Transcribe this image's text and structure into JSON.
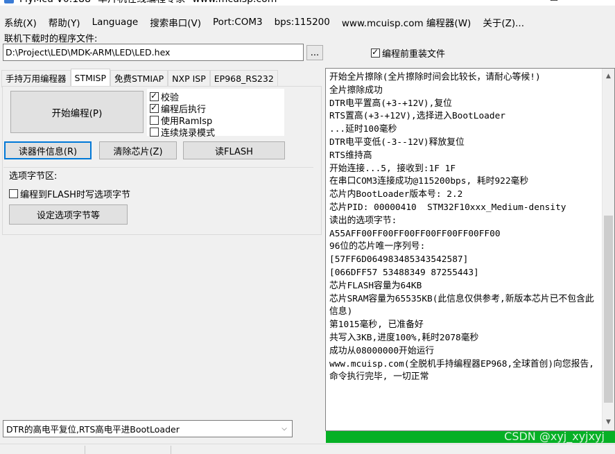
{
  "window": {
    "title": "FlyMcu V0.188--单片机在线编程专家--www.mcuisp.com",
    "minimize": "—",
    "maximize": "☐",
    "close": "✕"
  },
  "menu": [
    "系统(X)",
    "帮助(Y)",
    "Language",
    "搜索串口(V)",
    "Port:COM3",
    "bps:115200",
    "www.mcuisp.com 编程器(W)",
    "关于(Z)..."
  ],
  "file": {
    "label": "联机下载时的程序文件:",
    "path": "D:\\Project\\LED\\MDK-ARM\\LED\\LED.hex",
    "browse_label": "...",
    "reload_label": "编程前重装文件",
    "reload_checked": true
  },
  "tabs": [
    "手持万用编程器",
    "STMISP",
    "免费STMIAP",
    "NXP ISP",
    "EP968_RS232"
  ],
  "active_tab": "STMISP",
  "stmisp": {
    "start_program": "开始编程(P)",
    "verify": "校验",
    "run_after": "编程后执行",
    "use_ramisp": "使用RamIsp",
    "continuous": "连续烧录模式",
    "read_info": "读器件信息(R)",
    "erase_chip": "清除芯片(Z)",
    "read_flash": "读FLASH",
    "option_group": "选项字节区:",
    "write_option": "编程到FLASH时写选项字节",
    "set_option": "设定选项字节等"
  },
  "log_lines": [
    "开始全片擦除(全片擦除时间会比较长，请耐心等候!)",
    "全片擦除成功",
    "DTR电平置高(+3-+12V),复位",
    "RTS置高(+3-+12V),选择进入BootLoader",
    "...延时100毫秒",
    "DTR电平变低(-3--12V)释放复位",
    "RTS维持高",
    "开始连接...5, 接收到:1F 1F",
    "在串口COM3连接成功@115200bps, 耗时922毫秒",
    "芯片内BootLoader版本号: 2.2",
    "芯片PID: 00000410  STM32F10xxx_Medium-density",
    "读出的选项字节:",
    "A55AFF00FF00FF00FF00FF00FF00FF00",
    "96位的芯片唯一序列号:",
    "[57FF6D064983485343542587]",
    "[066DFF57 53488349 87255443]",
    "芯片FLASH容量为64KB",
    "芯片SRAM容量为65535KB(此信息仅供参考,新版本芯片已不包含此信息)",
    "第1015毫秒, 已准备好",
    "共写入3KB,进度100%,耗时2078毫秒",
    "成功从08000000开始运行",
    "www.mcuisp.com(全脱机手持编程器EP968,全球首创)向您报告, 命令执行完毕, 一切正常"
  ],
  "progress": 1.0,
  "watermark": "CSDN @xyj_xyjxyj",
  "dtr_mode": "DTR的高电平复位,RTS高电平进BootLoader",
  "icons": {
    "scroll_up": "▲",
    "scroll_down": "▼",
    "dropdown": "⌵"
  }
}
